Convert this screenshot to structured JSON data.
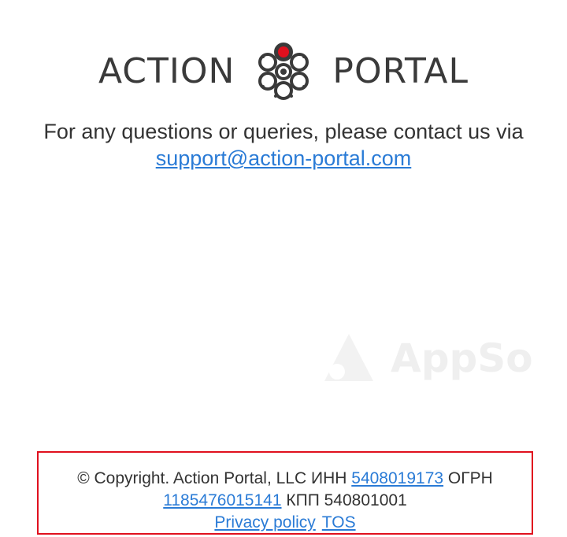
{
  "logo": {
    "word_left": "ACTION",
    "word_right": "PORTAL",
    "icon": "revolver-cylinder-icon",
    "accent_color": "#e0101e"
  },
  "contact": {
    "text": "For any questions or queries, please contact us via",
    "email": "support@action-portal.com"
  },
  "watermark": {
    "text": "AppSo",
    "icon": "appso-triangle-icon"
  },
  "footer": {
    "copyright": "© Copyright. Action Portal, LLC ИНН",
    "inn": "5408019173",
    "ogrn_label": "ОГРН",
    "ogrn": "1185476015141",
    "kpp_text": "КПП 540801001",
    "privacy": "Privacy policy",
    "tos": "TOS",
    "highlight_color": "#e0101e"
  },
  "colors": {
    "link": "#2a7bd6",
    "text": "#333333"
  }
}
